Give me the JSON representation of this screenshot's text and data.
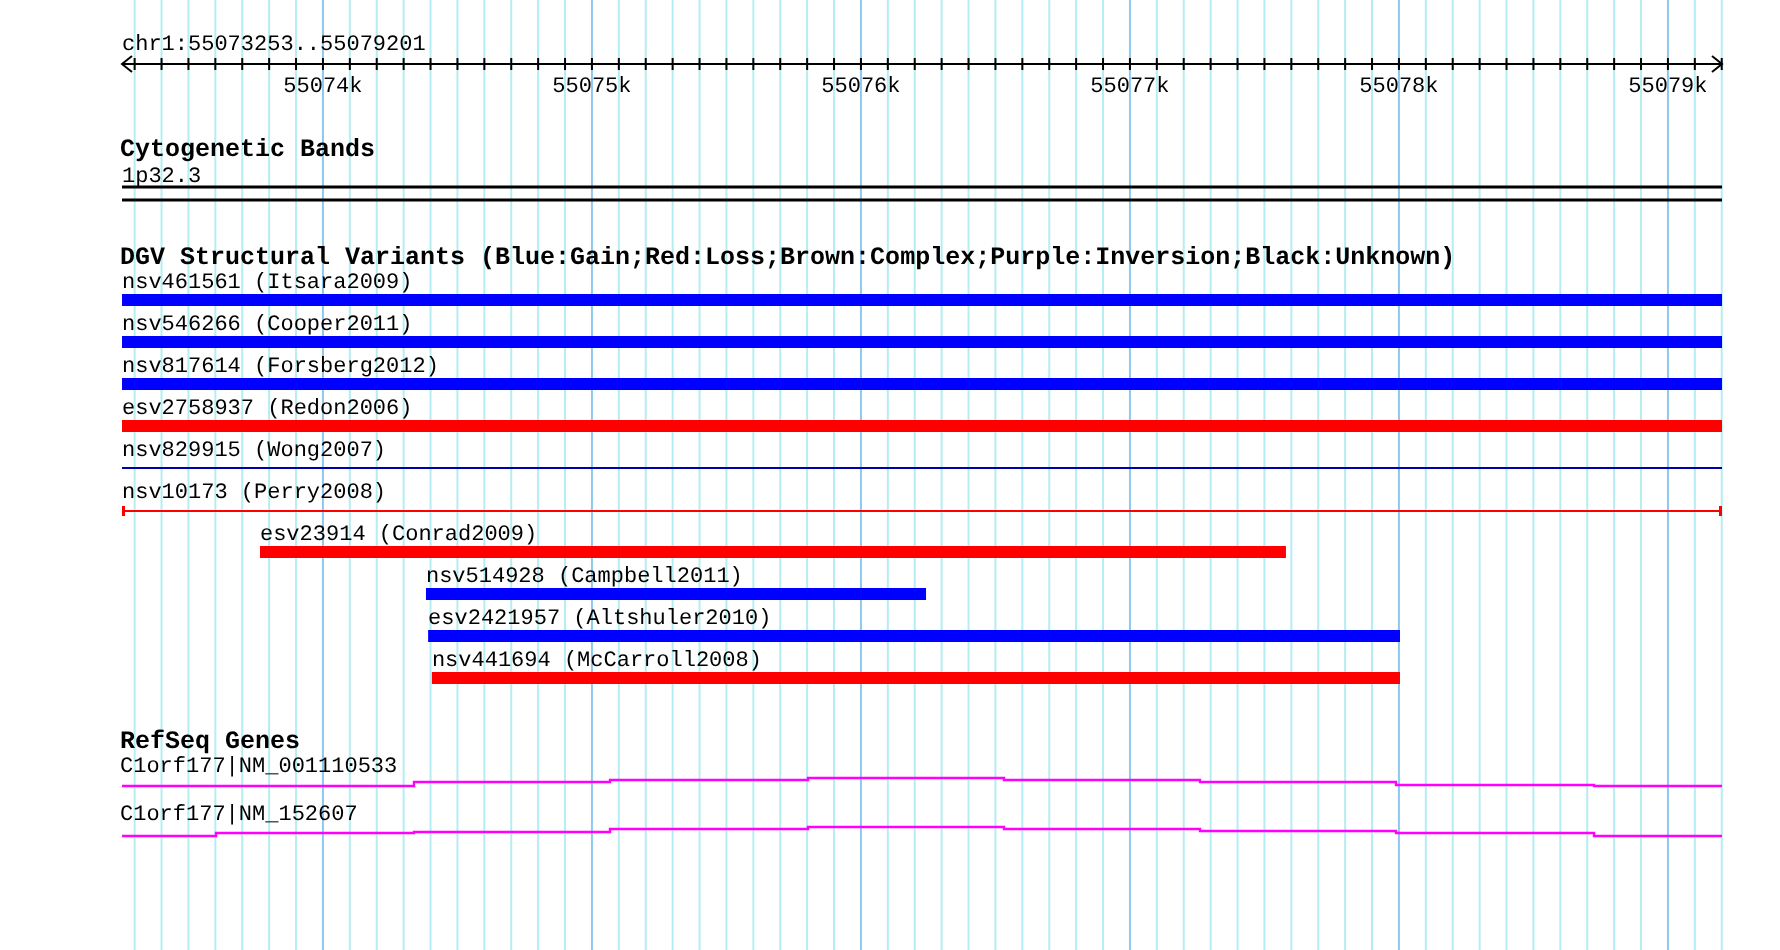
{
  "ruler": {
    "position": "chr1:55073253..55079201",
    "ticks": [
      "55074k",
      "55075k",
      "55076k",
      "55077k",
      "55078k",
      "55079k"
    ]
  },
  "cytogenetic_bands": {
    "title": "Cytogenetic Bands",
    "band": "1p32.3"
  },
  "variants": {
    "title": "DGV Structural Variants (Blue:Gain;Red:Loss;Brown:Complex;Purple:Inversion;Black:Unknown)",
    "items": [
      {
        "label": "nsv461561 (Itsara2009)",
        "kind": "thick",
        "color": "#0000ff"
      },
      {
        "label": "nsv546266 (Cooper2011)",
        "kind": "thick",
        "color": "#0000ff"
      },
      {
        "label": "nsv817614 (Forsberg2012)",
        "kind": "thick",
        "color": "#0000ff"
      },
      {
        "label": "esv2758937 (Redon2006)",
        "kind": "thick",
        "color": "#ff0000"
      },
      {
        "label": "nsv829915 (Wong2007)",
        "kind": "line",
        "color": "#0000aa"
      },
      {
        "label": "nsv10173 (Perry2008)",
        "kind": "ticked",
        "color": "#ff0000"
      },
      {
        "label": "esv23914 (Conrad2009)",
        "kind": "thick",
        "color": "#ff0000"
      },
      {
        "label": "nsv514928 (Campbell2011)",
        "kind": "thick",
        "color": "#0000ff"
      },
      {
        "label": "esv2421957 (Altshuler2010)",
        "kind": "thick",
        "color": "#0000ff"
      },
      {
        "label": "nsv441694 (McCarroll2008)",
        "kind": "thick",
        "color": "#ff0000"
      }
    ]
  },
  "genes": {
    "title": "RefSeq Genes",
    "items": [
      {
        "label": "C1orf177|NM_001110533"
      },
      {
        "label": "C1orf177|NM_152607"
      }
    ]
  }
}
